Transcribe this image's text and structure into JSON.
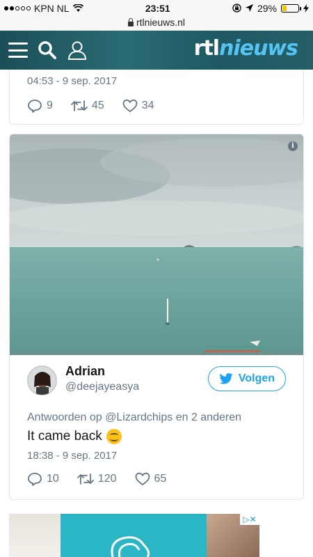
{
  "status_bar": {
    "carrier": "KPN NL",
    "time": "23:51",
    "battery": "29%",
    "battery_level": 0.29
  },
  "url_bar": {
    "url": "rtlnieuws.nl"
  },
  "header": {
    "logo_part1": "rtl",
    "logo_part2": "nieuws",
    "icons": [
      "menu-icon",
      "search-icon",
      "user-icon"
    ]
  },
  "tweet_prev": {
    "timestamp": "04:53 - 9 sep. 2017",
    "replies": "9",
    "retweets": "45",
    "likes": "34"
  },
  "tweet": {
    "author_name": "Adrian",
    "author_handle": "@deejayeasya",
    "follow_label": "Volgen",
    "reply_to": "Antwoorden op @Lizardchips en 2 anderen",
    "text": "It came back",
    "timestamp": "18:38 - 9 sep. 2017",
    "replies": "10",
    "retweets": "120",
    "likes": "65",
    "info_icon": "i"
  },
  "colors": {
    "twitter_blue": "#1da1f2",
    "muted": "#657786",
    "header_teal": "#1e5963",
    "logo_blue": "#55c4f2"
  }
}
